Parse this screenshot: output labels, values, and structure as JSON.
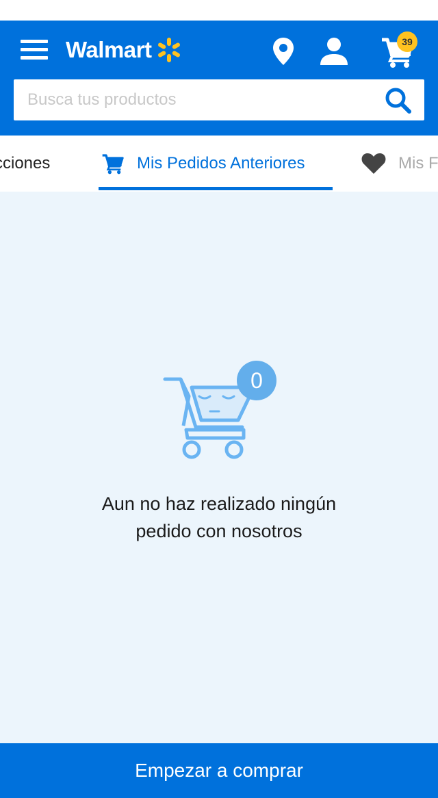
{
  "header": {
    "logo_text": "Walmart",
    "cart_count": "39",
    "accent_color": "#0071dc",
    "badge_color": "#ffc220"
  },
  "search": {
    "placeholder": "Busca tus productos",
    "value": ""
  },
  "tabs": [
    {
      "label": "cciones",
      "icon": ""
    },
    {
      "label": "Mis Pedidos Anteriores",
      "icon": "cart-icon",
      "active": true
    },
    {
      "label": "Mis F",
      "icon": "heart-icon"
    }
  ],
  "empty_state": {
    "illustration_count": "0",
    "line1": "Aun no haz realizado ningún",
    "line2": "pedido con nosotros"
  },
  "cta": {
    "label": "Empezar a comprar"
  }
}
